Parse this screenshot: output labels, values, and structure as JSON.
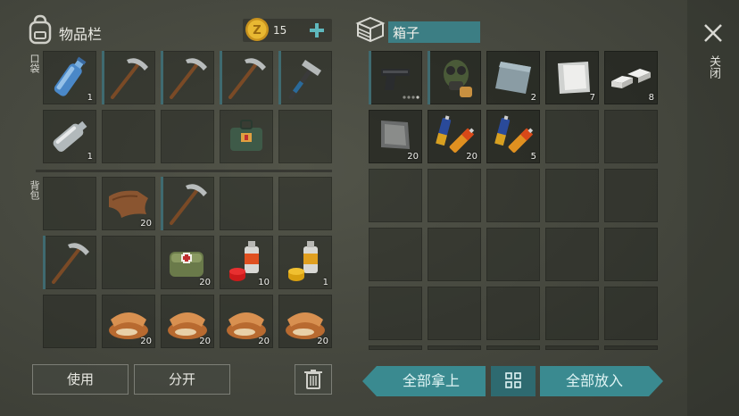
{
  "inventory": {
    "title": "物品栏",
    "coins": "15",
    "pockets_label": "口袋",
    "backpack_label": "背包",
    "pockets": [
      {
        "icon": "water-bottle-icon",
        "qty": "1"
      },
      {
        "icon": "pickaxe-icon",
        "qty": ""
      },
      {
        "icon": "pickaxe-icon",
        "qty": ""
      },
      {
        "icon": "pickaxe-icon",
        "qty": ""
      },
      {
        "icon": "hammer-icon",
        "qty": ""
      },
      {
        "icon": "empty-bottle-icon",
        "qty": "1"
      },
      {
        "icon": "",
        "qty": ""
      },
      {
        "icon": "",
        "qty": ""
      },
      {
        "icon": "medical-bag-icon",
        "qty": ""
      },
      {
        "icon": "",
        "qty": ""
      }
    ],
    "backpack": [
      {
        "icon": "",
        "qty": ""
      },
      {
        "icon": "leather-icon",
        "qty": "20"
      },
      {
        "icon": "pickaxe-icon",
        "qty": ""
      },
      {
        "icon": "",
        "qty": ""
      },
      {
        "icon": "",
        "qty": ""
      },
      {
        "icon": "pickaxe-icon",
        "qty": ""
      },
      {
        "icon": "",
        "qty": ""
      },
      {
        "icon": "first-aid-kit-icon",
        "qty": "20"
      },
      {
        "icon": "spray-can-red-icon",
        "qty": "10"
      },
      {
        "icon": "spray-can-yellow-icon",
        "qty": "1"
      },
      {
        "icon": "",
        "qty": ""
      },
      {
        "icon": "bread-icon",
        "qty": "20"
      },
      {
        "icon": "bread-icon",
        "qty": "20"
      },
      {
        "icon": "bread-icon",
        "qty": "20"
      },
      {
        "icon": "bread-icon",
        "qty": "20"
      }
    ],
    "use_label": "使用",
    "split_label": "分开"
  },
  "box": {
    "title": "箱子",
    "items": [
      {
        "icon": "pistol-icon",
        "qty": ""
      },
      {
        "icon": "gas-mask-icon",
        "qty": ""
      },
      {
        "icon": "metal-sheet-icon",
        "qty": "2"
      },
      {
        "icon": "aluminum-sheet-icon",
        "qty": "7"
      },
      {
        "icon": "metal-ingot-icon",
        "qty": "8"
      },
      {
        "icon": "iron-plate-icon",
        "qty": "20"
      },
      {
        "icon": "batteries-icon",
        "qty": "20"
      },
      {
        "icon": "batteries-icon",
        "qty": "5"
      }
    ],
    "take_all_label": "全部拿上",
    "put_all_label": "全部放入"
  },
  "close_label": "关闭",
  "colors": {
    "accent": "#3a8a90",
    "slot_bar": "#3f6a70",
    "coin": "#e0b030"
  }
}
